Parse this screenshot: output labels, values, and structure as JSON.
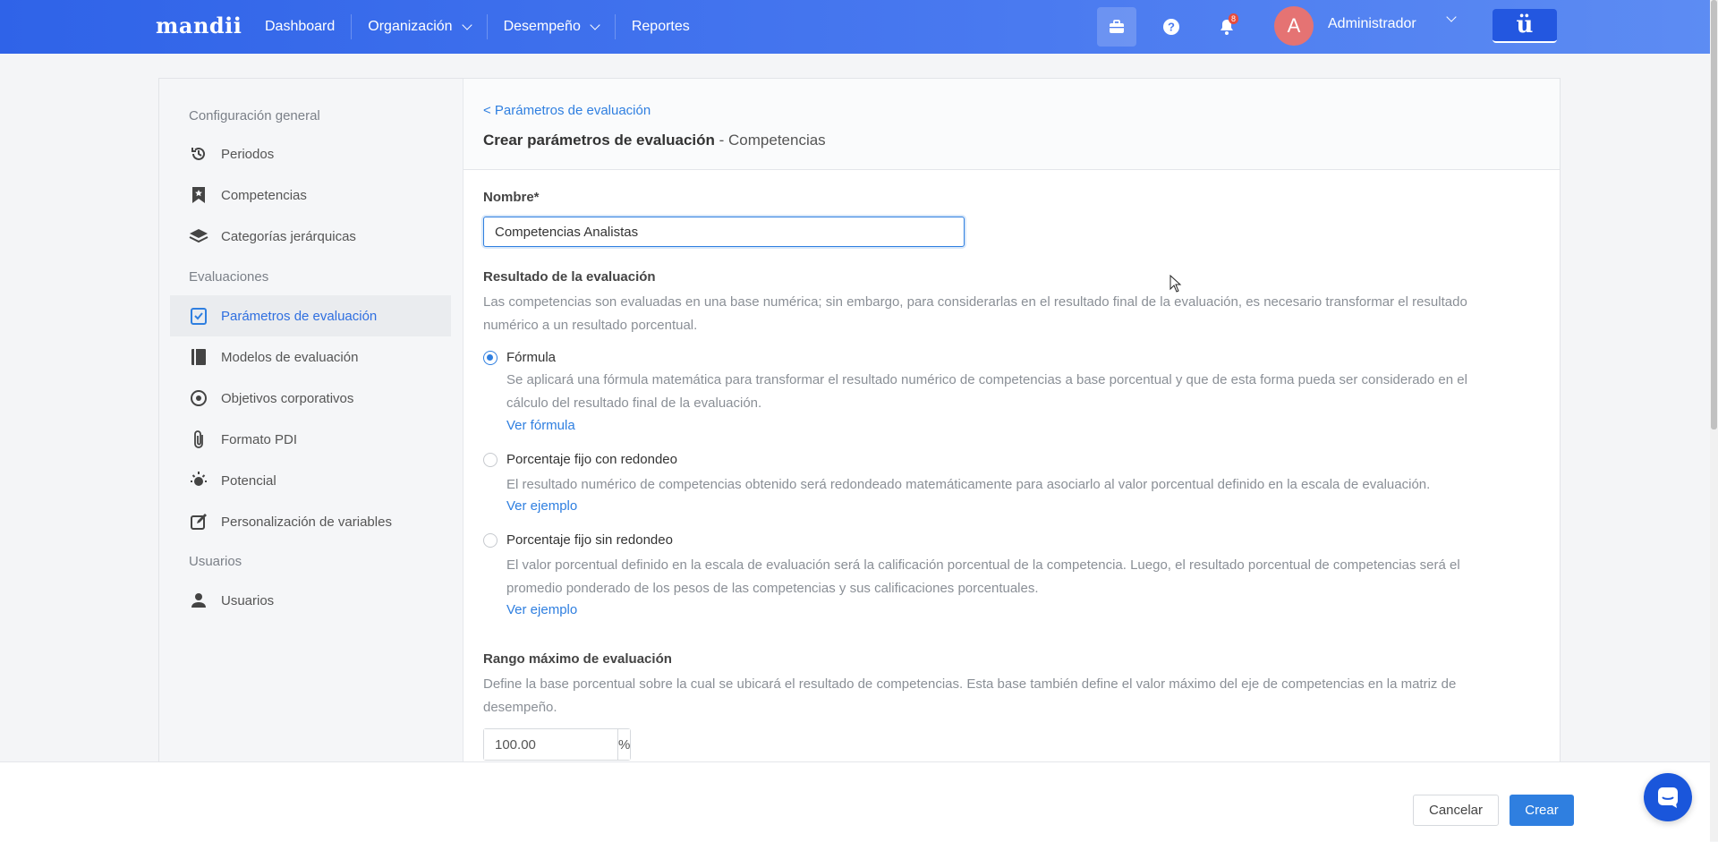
{
  "topbar": {
    "logo": "mandii",
    "nav": [
      {
        "label": "Dashboard",
        "has_dropdown": false
      },
      {
        "label": "Organización",
        "has_dropdown": true
      },
      {
        "label": "Desempeño",
        "has_dropdown": true
      },
      {
        "label": "Reportes",
        "has_dropdown": false
      }
    ],
    "notification_count": "8",
    "avatar_initial": "A",
    "user_name": "Administrador",
    "brand_button": "ü",
    "icons": [
      "briefcase-icon",
      "help-icon",
      "bell-icon"
    ]
  },
  "sidebar": {
    "sections": [
      {
        "title": "Configuración general",
        "items": [
          "Periodos",
          "Competencias",
          "Categorías jerárquicas"
        ]
      },
      {
        "title": "Evaluaciones",
        "items": [
          "Parámetros de evaluación",
          "Modelos de evaluación",
          "Objetivos corporativos",
          "Formato PDI",
          "Potencial",
          "Personalización de variables"
        ]
      },
      {
        "title": "Usuarios",
        "items": [
          "Usuarios"
        ]
      }
    ],
    "active_item": "Parámetros de evaluación"
  },
  "header": {
    "back_link": "< Parámetros de evaluación",
    "title_bold": "Crear parámetros de evaluación",
    "title_suffix": " - Competencias"
  },
  "form": {
    "name_label": "Nombre*",
    "name_value": "Competencias Analistas",
    "result_title": "Resultado de la evaluación",
    "result_desc": "Las competencias son evaluadas en una base numérica; sin embargo, para considerarlas en el resultado final de la evaluación, es necesario transformar el resultado numérico a un resultado porcentual.",
    "options": [
      {
        "label": "Fórmula",
        "checked": true,
        "desc": "Se aplicará una fórmula matemática para transformar el resultado numérico de competencias a base porcentual y que de esta forma pueda ser considerado en el cálculo del resultado final de la evaluación.",
        "link": "Ver fórmula"
      },
      {
        "label": "Porcentaje fijo con redondeo",
        "checked": false,
        "desc": "El resultado numérico de competencias obtenido será redondeado matemáticamente para asociarlo al valor porcentual definido en la escala de evaluación.",
        "link": "Ver ejemplo"
      },
      {
        "label": "Porcentaje fijo sin redondeo",
        "checked": false,
        "desc": "El valor porcentual definido en la escala de evaluación será la calificación porcentual de la competencia. Luego, el resultado porcentual de competencias será el promedio ponderado de los pesos de las competencias y sus calificaciones porcentuales.",
        "link": "Ver ejemplo"
      }
    ],
    "range_title": "Rango máximo de evaluación",
    "range_desc": "Define la base porcentual sobre la cual se ubicará el resultado de competencias. Esta base también define el valor máximo del eje de competencias en la matriz de desempeño.",
    "range_value": "100.00",
    "range_unit": "%"
  },
  "footer": {
    "cancel": "Cancelar",
    "create": "Crear"
  },
  "colors": {
    "accent": "#2f7fe0",
    "topbar": "#3a6ee8",
    "avatar": "#e57373",
    "badge": "#e74c3c"
  }
}
